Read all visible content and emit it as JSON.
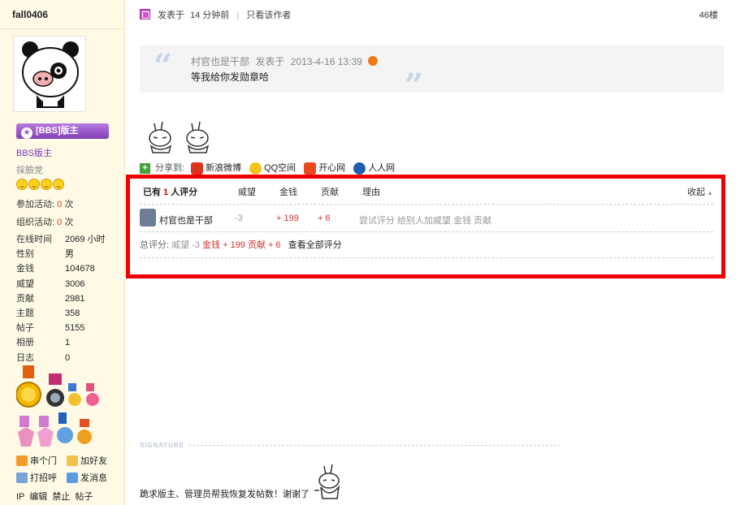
{
  "user": {
    "name": "fall0406",
    "group_badge": "[BBS]版主",
    "group_name": "BBS版主",
    "sub_group": "採臉党",
    "activities": [
      {
        "label": "参加活动:",
        "value": "0",
        "unit": "次"
      },
      {
        "label": "组织活动:",
        "value": "0",
        "unit": "次"
      }
    ],
    "stats": [
      {
        "k": "在线时间",
        "v": "2069 小时"
      },
      {
        "k": "性别",
        "v": "男"
      },
      {
        "k": "金钱",
        "v": "104678"
      },
      {
        "k": "威望",
        "v": "3006"
      },
      {
        "k": "贡献",
        "v": "2981"
      },
      {
        "k": "主题",
        "v": "358"
      },
      {
        "k": "帖子",
        "v": "5155"
      },
      {
        "k": "相册",
        "v": "1"
      },
      {
        "k": "日志",
        "v": "0"
      }
    ],
    "actions": {
      "visit": "串个门",
      "add_friend": "加好友",
      "greet": "打招呼",
      "message": "发消息"
    },
    "admin_links": [
      "IP",
      "编辑",
      "禁止",
      "帖子"
    ]
  },
  "post": {
    "posted_prefix": "发表于",
    "posted_time": "14 分钟前",
    "only_author": "只看该作者",
    "floor": "46楼",
    "quote": {
      "author": "村官也是干部",
      "posted_label": "发表于",
      "datetime": "2013-4-16 13:39",
      "text": "等我给你发勋章哈"
    },
    "share": {
      "label": "分享到:",
      "targets": [
        "新浪微博",
        "QQ空间",
        "开心网",
        "人人网"
      ]
    }
  },
  "ratings": {
    "count_prefix": "已有",
    "count": "1",
    "count_suffix": "人评分",
    "columns": [
      "威望",
      "金钱",
      "贡献",
      "理由"
    ],
    "collapse": "收起",
    "rows": [
      {
        "user": "村官也是干部",
        "prestige": "-3",
        "money": "+ 199",
        "contribution": "+ 6",
        "reason": "尝试评分 给别人加威望 金钱 贡献"
      }
    ],
    "total": {
      "label": "总评分:",
      "prestige_label": "威望",
      "prestige": "-3",
      "money_label": "金钱",
      "money": "+ 199",
      "contribution_label": "贡献",
      "contribution": "+ 6",
      "view_all": "查看全部评分"
    }
  },
  "signature": {
    "label": "SIGNATURE",
    "text": "跪求版主、管理员帮我恢复发帖数！谢谢了"
  },
  "colors": {
    "highlight_border": "#ee0000",
    "sidebar_bg": "#fefae6",
    "badge_purple": "#9a55cc",
    "positive_red": "#cc3333"
  }
}
